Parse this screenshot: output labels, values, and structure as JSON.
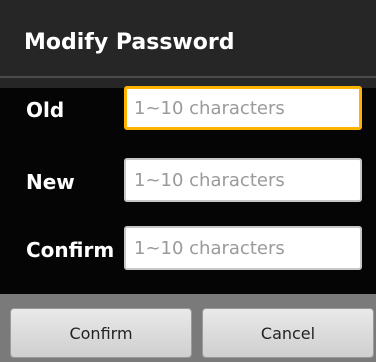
{
  "dialog": {
    "title": "Modify Password",
    "fields": [
      {
        "label": "Old",
        "placeholder": "1~10 characters",
        "value": ""
      },
      {
        "label": "New",
        "placeholder": "1~10 characters",
        "value": ""
      },
      {
        "label": "Confirm",
        "placeholder": "1~10 characters",
        "value": ""
      }
    ],
    "buttons": {
      "confirm": "Confirm",
      "cancel": "Cancel"
    }
  }
}
